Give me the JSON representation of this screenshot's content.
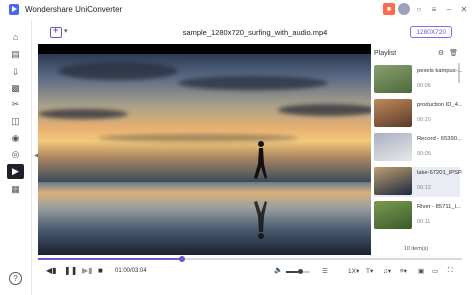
{
  "app": {
    "title": "Wondershare UniConverter"
  },
  "titlebar_icons": [
    "gift-icon",
    "user-avatar-icon",
    "headset-icon",
    "menu-icon",
    "minimize-icon",
    "close-icon"
  ],
  "sidebar": {
    "items": [
      {
        "name": "home-icon"
      },
      {
        "name": "converter-icon"
      },
      {
        "name": "downloader-icon"
      },
      {
        "name": "video-compressor-icon"
      },
      {
        "name": "video-editor-icon"
      },
      {
        "name": "merger-icon"
      },
      {
        "name": "screen-recorder-icon"
      },
      {
        "name": "dvd-burner-icon"
      },
      {
        "name": "player-icon"
      },
      {
        "name": "toolbox-icon"
      }
    ],
    "help": "?"
  },
  "player": {
    "filename": "sample_1280x720_surfing_with_audio.mp4",
    "resolution": "1280X720",
    "time_display": "01:00/03:04",
    "progress": 0.34,
    "volume": 0.6
  },
  "playlist": {
    "title": "Playlist",
    "count": "10 item(s)",
    "items": [
      {
        "name": "pexels kampus-...",
        "duration": "00:06",
        "colors": [
          "#4c6a3a",
          "#8aa070"
        ]
      },
      {
        "name": "production ID_4...",
        "duration": "00:20",
        "colors": [
          "#5a3a2a",
          "#c08a5a"
        ]
      },
      {
        "name": "Record - 65390...",
        "duration": "00:05",
        "colors": [
          "#e8e8ea",
          "#a8b0c0"
        ]
      },
      {
        "name": "lake-67201_lPSP...",
        "duration": "00:12",
        "colors": [
          "#1a2a40",
          "#c0a070"
        ],
        "selected": true
      },
      {
        "name": "River - 85711_l...",
        "duration": "00:11",
        "colors": [
          "#3a5a2a",
          "#7a9a50"
        ]
      }
    ]
  },
  "colors": {
    "accent": "#6a57d6",
    "sidebar_active": "#1f1f2e"
  }
}
